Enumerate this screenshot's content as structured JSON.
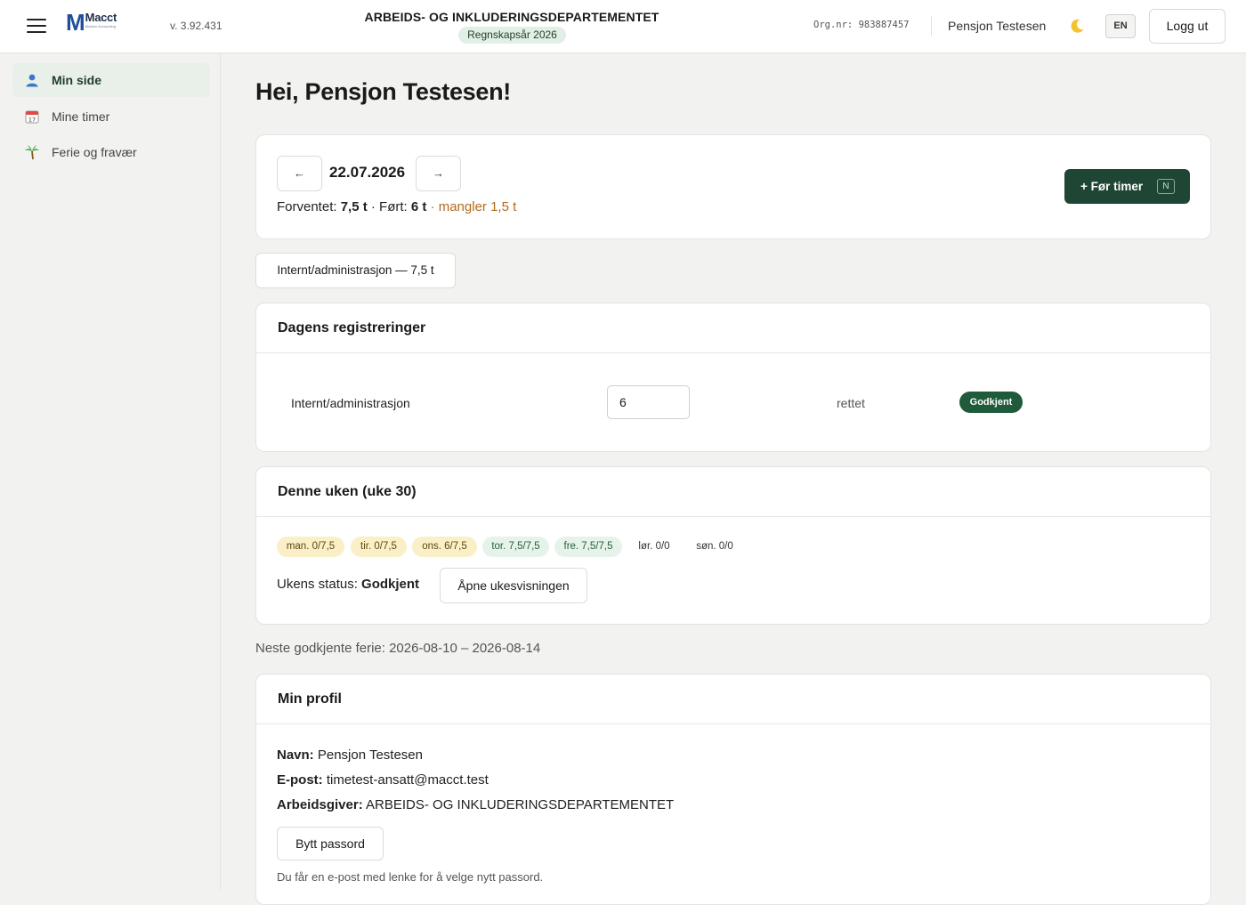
{
  "header": {
    "logo_name": "Macct",
    "logo_sub": "Modern Accounting",
    "version": "v. 3.92.431",
    "org_title": "ARBEIDS- OG INKLUDERINGSDEPARTEMENTET",
    "fiscal_year": "Regnskapsår 2026",
    "org_nr": "Org.nr: 983887457",
    "username": "Pensjon Testesen",
    "lang_label": "EN",
    "logout_label": "Logg ut"
  },
  "sidebar": {
    "items": [
      {
        "label": "Min side",
        "icon": "user-icon",
        "active": true
      },
      {
        "label": "Mine timer",
        "icon": "calendar-icon",
        "active": false
      },
      {
        "label": "Ferie og fravær",
        "icon": "palm-tree-icon",
        "active": false
      }
    ]
  },
  "main": {
    "greeting": "Hei, Pensjon Testesen!",
    "day_card": {
      "prev_label": "←",
      "next_label": "→",
      "date": "22.07.2026",
      "expected_label": "Forventet: ",
      "expected_value": "7,5 t",
      "sep1": " · Ført: ",
      "logged_value": "6 t",
      "missing": " · mangler 1,5 t",
      "log_button": "+ Før timer",
      "log_shortcut": "N"
    },
    "project_tab": "Internt/administrasjon — 7,5 t",
    "registrations": {
      "title": "Dagens registreringer",
      "rows": [
        {
          "project": "Internt/administrasjon",
          "hours": "6",
          "status": "rettet",
          "badge": "Godkjent"
        }
      ]
    },
    "week": {
      "title": "Denne uken (uke 30)",
      "days": [
        {
          "label": "man. 0/7,5",
          "state": "warn"
        },
        {
          "label": "tir. 0/7,5",
          "state": "warn"
        },
        {
          "label": "ons. 6/7,5",
          "state": "warn"
        },
        {
          "label": "tor. 7,5/7,5",
          "state": "ok"
        },
        {
          "label": "fre. 7,5/7,5",
          "state": "ok"
        },
        {
          "label": "lør. 0/0",
          "state": "plain"
        },
        {
          "label": "søn. 0/0",
          "state": "plain"
        }
      ],
      "status_label": "Ukens status: ",
      "status_value": "Godkjent",
      "open_button": "Åpne ukesvisningen"
    },
    "next_vacation": "Neste godkjente ferie: 2026-08-10 – 2026-08-14",
    "profile": {
      "title": "Min profil",
      "name_label": "Navn:",
      "name_value": " Pensjon Testesen",
      "email_label": "E-post:",
      "email_value": " timetest-ansatt@macct.test",
      "employer_label": "Arbeidsgiver:",
      "employer_value": " ARBEIDS- OG INKLUDERINGSDEPARTEMENTET",
      "password_button": "Bytt passord",
      "password_note": "Du får en e-post med lenke for å velge nytt passord."
    }
  },
  "colors": {
    "accent": "#1f4534",
    "warning": "#b26a1e",
    "badge_green": "#1f5a3a"
  }
}
